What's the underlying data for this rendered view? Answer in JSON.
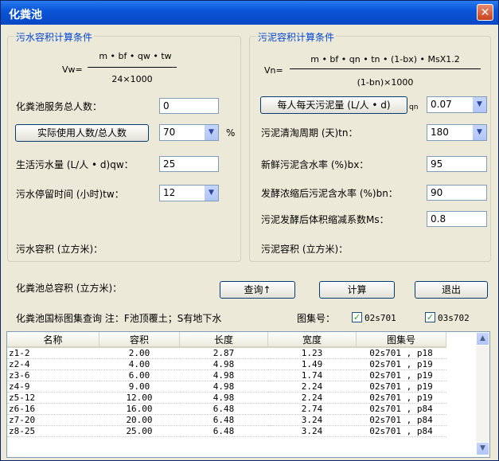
{
  "window": {
    "title": "化粪池",
    "close_icon": "✕"
  },
  "left_group": {
    "title": "污水容积计算条件",
    "formula": {
      "lhs": "Vw=",
      "numerator": "m • bf • qw • tw",
      "denominator": "24×1000"
    },
    "service_people_label": "化粪池服务总人数：",
    "service_people_value": "0",
    "ratio_button_label": "实际使用人数/总人数",
    "ratio_value": "70",
    "ratio_unit": "%",
    "sewage_amount_label": "生活污水量 (L/人 • d)qw：",
    "sewage_amount_value": "25",
    "retention_time_label": "污水停留时间 (小时)tw：",
    "retention_time_value": "12",
    "sewage_volume_label": "污水容积 (立方米)："
  },
  "right_group": {
    "title": "污泥容积计算条件",
    "formula": {
      "lhs": "Vn=",
      "numerator": "m • bf • qn • tn • (1-bx) • MsX1.2",
      "denominator": "(1-bn)×1000"
    },
    "sludge_per_person_button_label": "每人每天污泥量 (L/人 • d)",
    "sludge_per_person_suffix": "qn",
    "sludge_per_person_value": "0.07",
    "cleaning_period_label": "污泥清淘周期 (天)tn：",
    "cleaning_period_value": "180",
    "fresh_water_content_label": "新鲜污泥含水率 (%)bx：",
    "fresh_water_content_value": "95",
    "ferment_water_content_label": "发酵浓缩后污泥含水率 (%)bn：",
    "ferment_water_content_value": "90",
    "reduction_coef_label": "污泥发酵后体积缩减系数Ms：",
    "reduction_coef_value": "0.8",
    "sludge_volume_label": "污泥容积 (立方米)："
  },
  "total_volume_label": "化粪池总容积 (立方米)：",
  "buttons": {
    "query": "查询↑",
    "calculate": "计算",
    "exit": "退出"
  },
  "atlas": {
    "label": "化粪池国标图集查询  注：F池顶覆土；S有地下水",
    "number_label": "图集号：",
    "options": [
      {
        "label": "02s701",
        "checked": true
      },
      {
        "label": "03s702",
        "checked": true
      }
    ]
  },
  "table": {
    "columns": [
      "名称",
      "容积",
      "长度",
      "宽度",
      "图集号"
    ],
    "rows": [
      [
        "z1-2",
        "2.00",
        "2.87",
        "1.23",
        "02s701 , p18"
      ],
      [
        "z2-4",
        "4.00",
        "4.98",
        "1.49",
        "02s701 , p19"
      ],
      [
        "z3-6",
        "6.00",
        "4.98",
        "1.74",
        "02s701 , p19"
      ],
      [
        "z4-9",
        "9.00",
        "4.98",
        "2.24",
        "02s701 , p19"
      ],
      [
        "z5-12",
        "12.00",
        "4.98",
        "2.24",
        "02s701 , p19"
      ],
      [
        "z6-16",
        "16.00",
        "6.48",
        "2.74",
        "02s701 , p84"
      ],
      [
        "z7-20",
        "20.00",
        "6.48",
        "3.24",
        "02s701 , p84"
      ],
      [
        "z8-25",
        "25.00",
        "6.48",
        "3.24",
        "02s701 , p84"
      ]
    ]
  },
  "icons": {
    "dropdown": "chevron-down-icon",
    "close": "close-icon",
    "scroll_up": "arrow-up-icon",
    "scroll_down": "arrow-down-icon",
    "check": "checkmark-icon"
  }
}
